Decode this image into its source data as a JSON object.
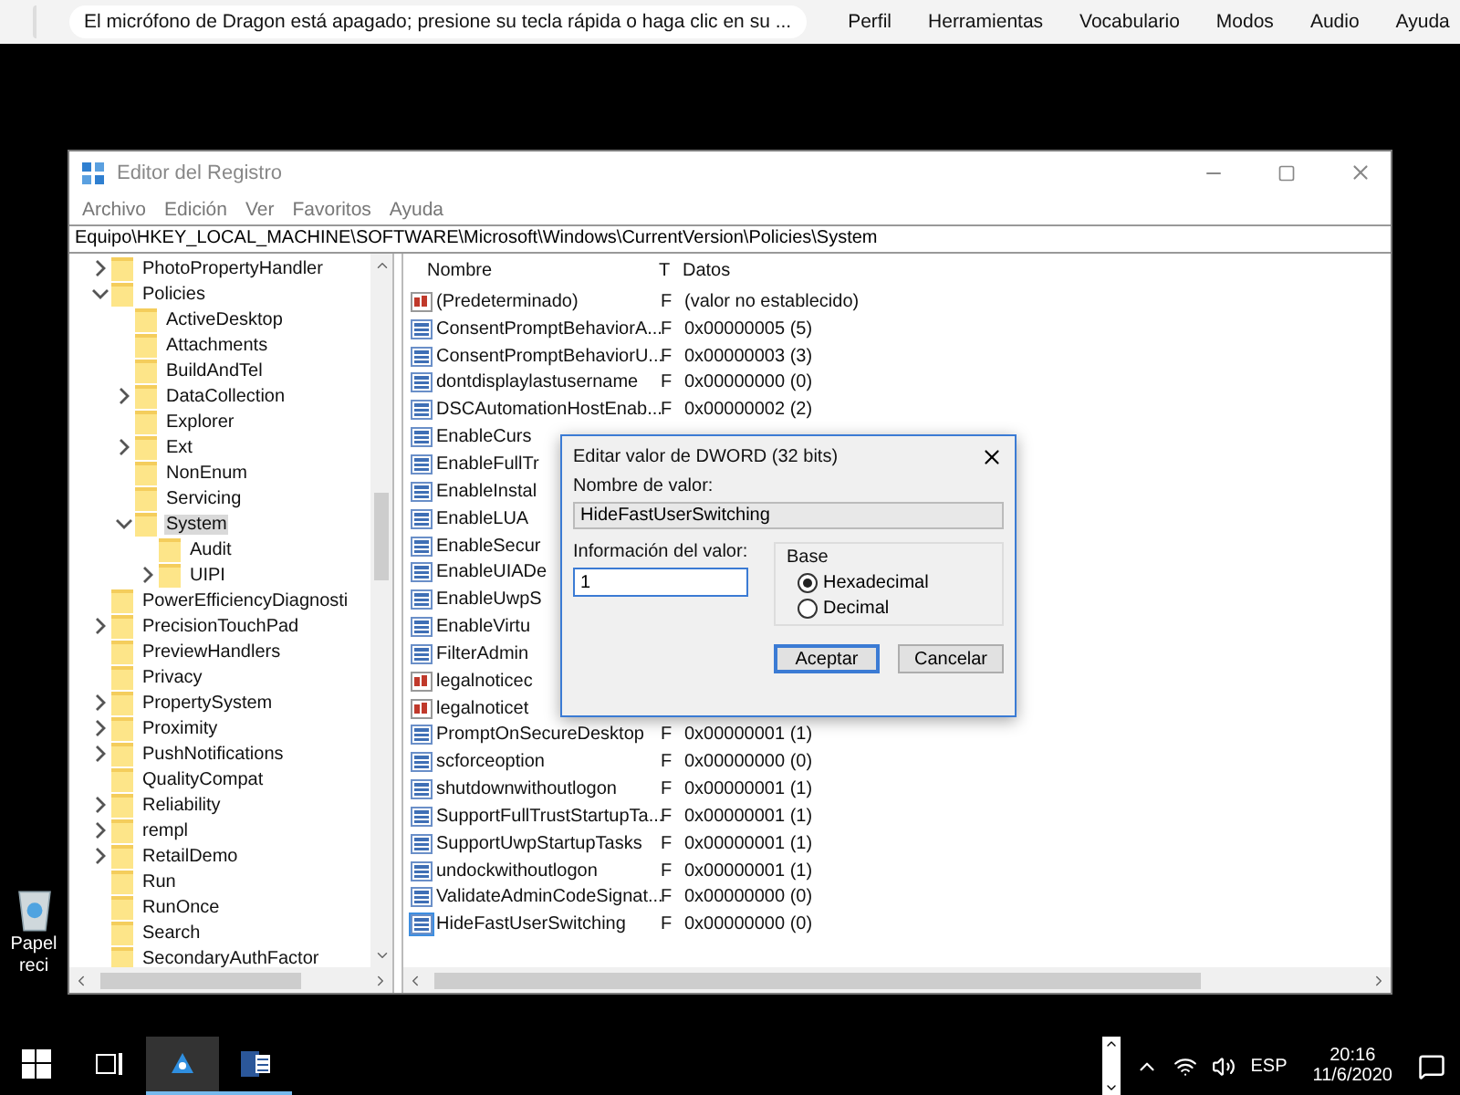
{
  "dragon_bar": {
    "message": "El micrófono de Dragon está apagado; presione su tecla rápida o haga clic en su ...",
    "menus": [
      "Perfil",
      "Herramientas",
      "Vocabulario",
      "Modos",
      "Audio",
      "Ayuda"
    ]
  },
  "desktop_icon": {
    "label_lines": [
      "Papel",
      "reci"
    ]
  },
  "window": {
    "title": "Editor del Registro",
    "menus": [
      "Archivo",
      "Edición",
      "Ver",
      "Favoritos",
      "Ayuda"
    ],
    "address": "Equipo\\HKEY_LOCAL_MACHINE\\SOFTWARE\\Microsoft\\Windows\\CurrentVersion\\Policies\\System",
    "tree": [
      {
        "label": "PhotoPropertyHandler",
        "expanded": false,
        "selected": false
      },
      {
        "label": "Policies",
        "expanded": true,
        "selected": false,
        "children": [
          {
            "label": "ActiveDesktop",
            "selected": false
          },
          {
            "label": "Attachments",
            "selected": false
          },
          {
            "label": "BuildAndTel",
            "selected": false
          },
          {
            "label": "DataCollection",
            "expanded": false,
            "selected": false
          },
          {
            "label": "Explorer",
            "selected": false
          },
          {
            "label": "Ext",
            "expanded": false,
            "selected": false
          },
          {
            "label": "NonEnum",
            "selected": false
          },
          {
            "label": "Servicing",
            "selected": false
          },
          {
            "label": "System",
            "expanded": true,
            "selected": true,
            "children": [
              {
                "label": "Audit",
                "selected": false
              },
              {
                "label": "UIPI",
                "expanded": false,
                "selected": false
              }
            ]
          }
        ]
      },
      {
        "label": "PowerEfficiencyDiagnosti",
        "selected": false
      },
      {
        "label": "PrecisionTouchPad",
        "expanded": false,
        "selected": false
      },
      {
        "label": "PreviewHandlers",
        "selected": false
      },
      {
        "label": "Privacy",
        "selected": false
      },
      {
        "label": "PropertySystem",
        "expanded": false,
        "selected": false
      },
      {
        "label": "Proximity",
        "expanded": false,
        "selected": false
      },
      {
        "label": "PushNotifications",
        "expanded": false,
        "selected": false
      },
      {
        "label": "QualityCompat",
        "selected": false
      },
      {
        "label": "Reliability",
        "expanded": false,
        "selected": false
      },
      {
        "label": "rempl",
        "expanded": false,
        "selected": false
      },
      {
        "label": "RetailDemo",
        "expanded": false,
        "selected": false
      },
      {
        "label": "Run",
        "selected": false
      },
      {
        "label": "RunOnce",
        "selected": false
      },
      {
        "label": "Search",
        "selected": false
      },
      {
        "label": "SecondaryAuthFactor",
        "selected": false
      }
    ],
    "list": {
      "columns": [
        "Nombre",
        "T",
        "Datos"
      ],
      "rows": [
        {
          "kind": "string",
          "name": "(Predeterminado)",
          "type": "F",
          "data": "(valor no establecido)",
          "selected": false
        },
        {
          "kind": "dword",
          "name": "ConsentPromptBehaviorA...",
          "type": "F",
          "data": "0x00000005 (5)",
          "selected": false
        },
        {
          "kind": "dword",
          "name": "ConsentPromptBehaviorU...",
          "type": "F",
          "data": "0x00000003 (3)",
          "selected": false
        },
        {
          "kind": "dword",
          "name": "dontdisplaylastusername",
          "type": "F",
          "data": "0x00000000 (0)",
          "selected": false
        },
        {
          "kind": "dword",
          "name": "DSCAutomationHostEnab...",
          "type": "F",
          "data": "0x00000002 (2)",
          "selected": false
        },
        {
          "kind": "dword",
          "name": "EnableCurs",
          "selected": false
        },
        {
          "kind": "dword",
          "name": "EnableFullTr",
          "selected": false
        },
        {
          "kind": "dword",
          "name": "EnableInstal",
          "selected": false
        },
        {
          "kind": "dword",
          "name": "EnableLUA",
          "selected": false
        },
        {
          "kind": "dword",
          "name": "EnableSecur",
          "selected": false
        },
        {
          "kind": "dword",
          "name": "EnableUIADe",
          "selected": false
        },
        {
          "kind": "dword",
          "name": "EnableUwpS",
          "selected": false
        },
        {
          "kind": "dword",
          "name": "EnableVirtu",
          "selected": false
        },
        {
          "kind": "dword",
          "name": "FilterAdmin",
          "selected": false
        },
        {
          "kind": "string",
          "name": "legalnoticec",
          "selected": false
        },
        {
          "kind": "string",
          "name": "legalnoticet",
          "selected": false
        },
        {
          "kind": "dword",
          "name": "PromptOnSecureDesktop",
          "type": "F",
          "data": "0x00000001 (1)",
          "selected": false
        },
        {
          "kind": "dword",
          "name": "scforceoption",
          "type": "F",
          "data": "0x00000000 (0)",
          "selected": false
        },
        {
          "kind": "dword",
          "name": "shutdownwithoutlogon",
          "type": "F",
          "data": "0x00000001 (1)",
          "selected": false
        },
        {
          "kind": "dword",
          "name": "SupportFullTrustStartupTa...",
          "type": "F",
          "data": "0x00000001 (1)",
          "selected": false
        },
        {
          "kind": "dword",
          "name": "SupportUwpStartupTasks",
          "type": "F",
          "data": "0x00000001 (1)",
          "selected": false
        },
        {
          "kind": "dword",
          "name": "undockwithoutlogon",
          "type": "F",
          "data": "0x00000001 (1)",
          "selected": false
        },
        {
          "kind": "dword",
          "name": "ValidateAdminCodeSignat...",
          "type": "F",
          "data": "0x00000000 (0)",
          "selected": false
        },
        {
          "kind": "dword",
          "name": "HideFastUserSwitching",
          "type": "F",
          "data": "0x00000000 (0)",
          "selected": true
        }
      ]
    }
  },
  "dialog": {
    "title": "Editar valor de DWORD (32 bits)",
    "name_label": "Nombre de valor:",
    "name_value": "HideFastUserSwitching",
    "data_label": "Información del valor:",
    "data_value": "1",
    "base_label": "Base",
    "radios": [
      {
        "label": "Hexadecimal",
        "selected": true
      },
      {
        "label": "Decimal",
        "selected": false
      }
    ],
    "buttons": [
      {
        "label": "Aceptar",
        "default": true
      },
      {
        "label": "Cancelar",
        "default": false
      }
    ]
  },
  "taskbar": {
    "apps": [
      {
        "kind": "dragon",
        "active": true
      },
      {
        "kind": "word",
        "active": false
      }
    ],
    "language": "ESP",
    "time": "20:16",
    "date": "11/6/2020"
  }
}
